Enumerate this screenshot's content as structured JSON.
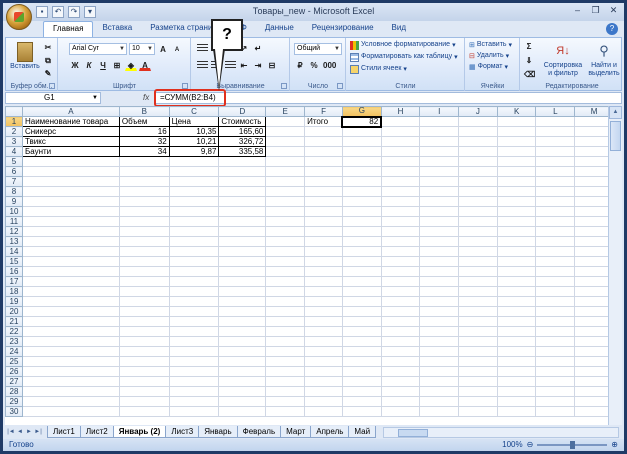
{
  "window": {
    "title": "Товары_new - Microsoft Excel"
  },
  "ribbon": {
    "tabs": [
      "Главная",
      "Вставка",
      "Разметка страницы",
      "Ф",
      "Данные",
      "Рецензирование",
      "Вид"
    ],
    "active_tab": "Главная",
    "clipboard": {
      "paste_label": "Вставить",
      "group_label": "Буфер обм..."
    },
    "font": {
      "family": "Arial Cyr",
      "size": "10",
      "group_label": "Шрифт"
    },
    "alignment": {
      "group_label": "Выравнивание"
    },
    "number": {
      "format": "Общий",
      "group_label": "Число"
    },
    "styles": {
      "items": [
        "Условное форматирование",
        "Форматировать как таблицу",
        "Стили ячеек"
      ],
      "group_label": "Стили"
    },
    "cells": {
      "items": [
        "Вставить",
        "Удалить",
        "Формат"
      ],
      "group_label": "Ячейки"
    },
    "editing": {
      "sort_label": "Сортировка и фильтр",
      "find_label": "Найти и выделить",
      "group_label": "Редактирование"
    }
  },
  "formula_bar": {
    "name_box": "G1",
    "fx": "fx",
    "formula": "=СУММ(B2:B4)"
  },
  "callout": {
    "text": "?"
  },
  "sheet": {
    "columns": [
      "A",
      "B",
      "C",
      "D",
      "E",
      "F",
      "G",
      "H",
      "I",
      "J",
      "K",
      "L",
      "M"
    ],
    "row_count": 30,
    "selected_cell": "G1",
    "cells": {
      "A1": "Наименование товара",
      "B1": "Объем",
      "C1": "Цена",
      "D1": "Стоимость",
      "A2": "Сникерс",
      "B2": "16",
      "C2": "10,35",
      "D2": "165,60",
      "A3": "Твикс",
      "B3": "32",
      "C3": "10,21",
      "D3": "326,72",
      "A4": "Баунти",
      "B4": "34",
      "C4": "9,87",
      "D4": "335,58",
      "F1": "Итого",
      "G1": "82"
    }
  },
  "sheet_tabs": {
    "tabs": [
      "Лист1",
      "Лист2",
      "Январь (2)",
      "Лист3",
      "Январь",
      "Февраль",
      "Март",
      "Апрель",
      "Май"
    ],
    "active": "Январь (2)"
  },
  "status_bar": {
    "status": "Готово",
    "zoom": "100%"
  }
}
